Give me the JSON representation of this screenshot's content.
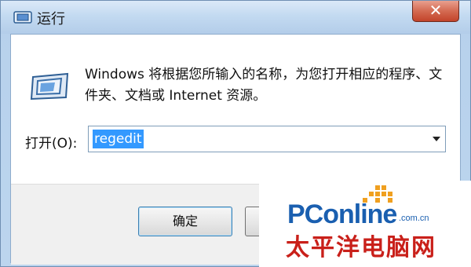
{
  "window": {
    "title": "运行",
    "close_label": "✕"
  },
  "dialog": {
    "description": "Windows 将根据您所输入的名称，为您打开相应的程序、文件夹、文档或 Internet 资源。",
    "open_label": "打开(O):",
    "command_value": "regedit",
    "ok_label": "确定"
  },
  "watermark": {
    "logo": "PConline",
    "domain": ".com.cn",
    "name": "太平洋电脑网"
  },
  "colors": {
    "accent": "#3399ff",
    "close_red": "#c2432a",
    "brand_blue": "#1a5fb0",
    "brand_red": "#c9201a"
  },
  "icons": {
    "title": "run-window-icon",
    "main": "run-app-icon",
    "dropdown": "chevron-down-icon"
  }
}
